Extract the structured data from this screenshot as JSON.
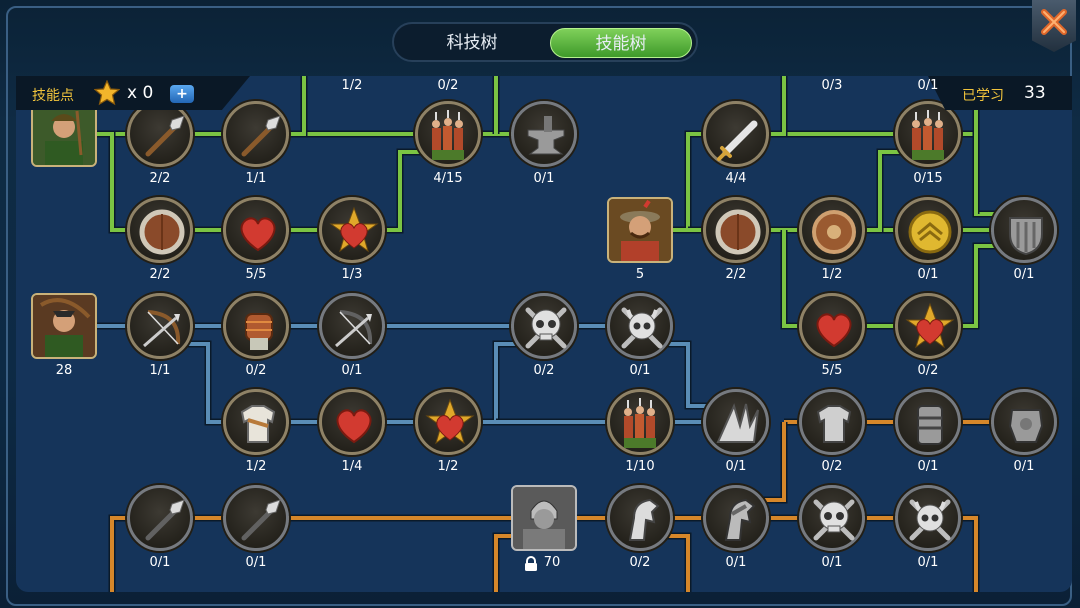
{
  "tabs": [
    {
      "label": "科技树",
      "active": false
    },
    {
      "label": "技能树",
      "active": true
    }
  ],
  "skill_points": {
    "label": "技能点",
    "value": "x 0",
    "plus": "+"
  },
  "learned": {
    "label": "已学习",
    "value": "33"
  },
  "colors": {
    "green_line": "#7bc443",
    "blue_line": "#5a8db6",
    "orange_line": "#d6872a",
    "tab_active": "#4fae35",
    "gold": "#f0c33c"
  },
  "top_counts": [
    "1/2",
    "0/2",
    "0/3",
    "0/1"
  ],
  "nodes": [
    {
      "id": "g-spear1",
      "icon": "spear-icon",
      "count": "2/2",
      "lit": true
    },
    {
      "id": "g-spear2",
      "icon": "spear-icon",
      "count": "1/1",
      "lit": true
    },
    {
      "id": "g-troops1",
      "icon": "troops-icon",
      "count": "4/15",
      "lit": true
    },
    {
      "id": "g-anvil",
      "icon": "anvil-icon",
      "count": "0/1",
      "lit": false
    },
    {
      "id": "g-shield1",
      "icon": "wooden-shield-icon",
      "count": "2/2",
      "lit": true
    },
    {
      "id": "g-heart1",
      "icon": "heart-icon",
      "count": "5/5",
      "lit": true
    },
    {
      "id": "g-heartstar1",
      "icon": "star-heart-icon",
      "count": "1/3",
      "lit": true
    },
    {
      "id": "r-sword",
      "icon": "sword-icon",
      "count": "4/4",
      "lit": true
    },
    {
      "id": "r-troops2",
      "icon": "troops-icon",
      "count": "0/15",
      "lit": true
    },
    {
      "id": "r-shield2",
      "icon": "wooden-shield-icon",
      "count": "2/2",
      "lit": true
    },
    {
      "id": "r-shield3",
      "icon": "round-shield-icon",
      "count": "1/2",
      "lit": true
    },
    {
      "id": "r-goldshield",
      "icon": "gold-shield-icon",
      "count": "0/1",
      "lit": true
    },
    {
      "id": "r-fortress",
      "icon": "fortress-shield-icon",
      "count": "0/1",
      "lit": false
    },
    {
      "id": "r-heart2",
      "icon": "heart-icon",
      "count": "5/5",
      "lit": true
    },
    {
      "id": "r-heartstar2",
      "icon": "star-heart-icon",
      "count": "0/2",
      "lit": true
    },
    {
      "id": "b-bow",
      "icon": "bow-icon",
      "count": "1/1",
      "lit": true
    },
    {
      "id": "b-fist",
      "icon": "fist-icon",
      "count": "0/2",
      "lit": true
    },
    {
      "id": "b-bow2",
      "icon": "bow-icon",
      "count": "0/1",
      "lit": false
    },
    {
      "id": "b-skull1",
      "icon": "skull-icon",
      "count": "0/2",
      "lit": false
    },
    {
      "id": "b-skull2",
      "icon": "horned-skull-icon",
      "count": "0/1",
      "lit": false
    },
    {
      "id": "b-armor",
      "icon": "light-armor-icon",
      "count": "1/2",
      "lit": true
    },
    {
      "id": "b-heart3",
      "icon": "heart-icon",
      "count": "1/4",
      "lit": true
    },
    {
      "id": "b-heartstar3",
      "icon": "star-heart-icon",
      "count": "1/2",
      "lit": true
    },
    {
      "id": "b-troops3",
      "icon": "troops-icon",
      "count": "1/10",
      "lit": true
    },
    {
      "id": "b-spikes",
      "icon": "spikes-icon",
      "count": "0/1",
      "lit": false
    },
    {
      "id": "o-armor1",
      "icon": "armor-icon",
      "count": "0/2",
      "lit": false
    },
    {
      "id": "o-armor2",
      "icon": "heavy-armor-icon",
      "count": "0/1",
      "lit": false
    },
    {
      "id": "o-armor3",
      "icon": "plate-armor-icon",
      "count": "0/1",
      "lit": false
    },
    {
      "id": "o-spear1",
      "icon": "spear-icon",
      "count": "0/1",
      "lit": false
    },
    {
      "id": "o-spear2",
      "icon": "spear-icon",
      "count": "0/1",
      "lit": false
    },
    {
      "id": "o-horse1",
      "icon": "horse-icon",
      "count": "0/2",
      "lit": false
    },
    {
      "id": "o-horse2",
      "icon": "armored-horse-icon",
      "count": "0/1",
      "lit": false
    },
    {
      "id": "o-skull3",
      "icon": "skull-icon",
      "count": "0/1",
      "lit": false
    },
    {
      "id": "o-skull4",
      "icon": "horned-skull-icon",
      "count": "0/1",
      "lit": false
    }
  ],
  "heroes": [
    {
      "id": "hero-archer",
      "icon": "hunter-portrait",
      "count": ""
    },
    {
      "id": "hero-soldier",
      "icon": "soldier-portrait",
      "count": "5"
    },
    {
      "id": "hero-bowman",
      "icon": "bowman-portrait",
      "count": "28"
    },
    {
      "id": "hero-knight",
      "icon": "knight-portrait",
      "count": "70",
      "locked": true
    }
  ]
}
